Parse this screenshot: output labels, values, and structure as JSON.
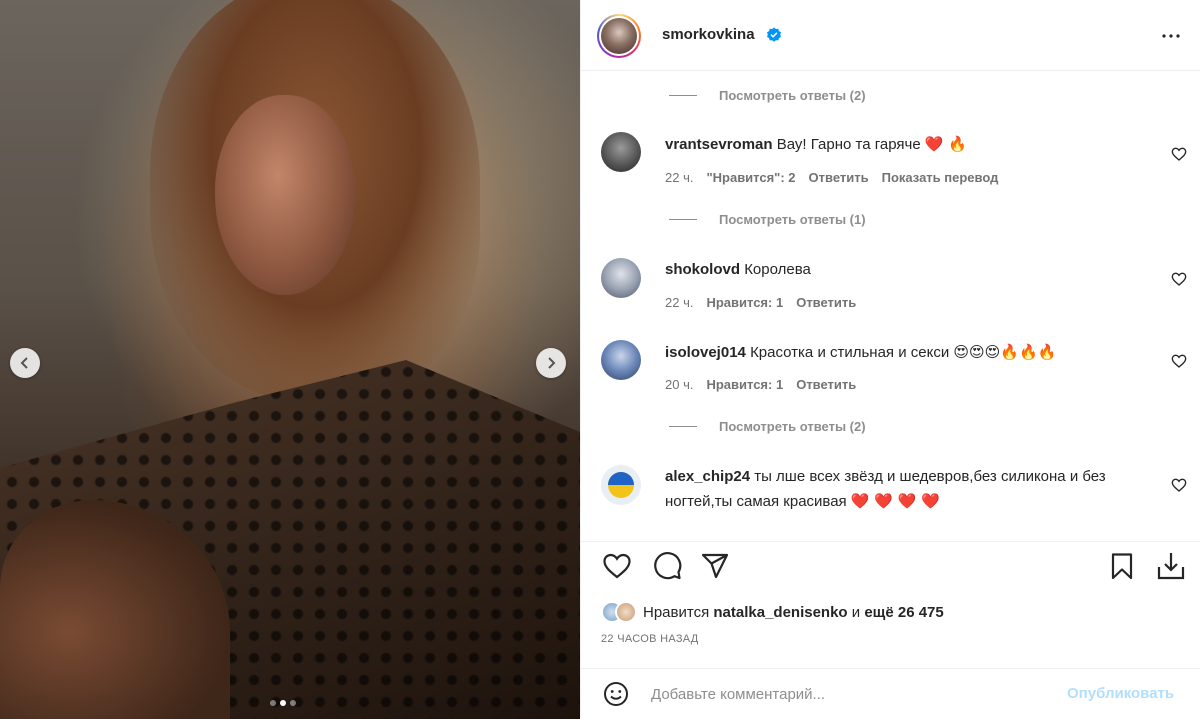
{
  "post": {
    "author": "smorkovkina",
    "verified": true,
    "carousel": {
      "total": 3,
      "current": 2
    }
  },
  "comments": [
    {
      "view_replies": "Посмотреть ответы (2)"
    },
    {
      "user": "vrantsevroman",
      "text": "Вау! Гарно та гаряче",
      "emojis": "❤️ 🔥",
      "time": "22 ч.",
      "likes": "\"Нравится\": 2",
      "reply": "Ответить",
      "translate": "Показать перевод",
      "view_replies": "Посмотреть ответы (1)"
    },
    {
      "user": "shokolovd",
      "text": "Королева",
      "time": "22 ч.",
      "likes": "Нравится: 1",
      "reply": "Ответить"
    },
    {
      "user": "isolovej014",
      "text": "Красотка и стильная и секси",
      "emojis": "😍😍😍🔥🔥🔥",
      "time": "20 ч.",
      "likes": "Нравится: 1",
      "reply": "Ответить",
      "view_replies": "Посмотреть ответы (2)"
    },
    {
      "user": "alex_chip24",
      "text": "ты лше всех звёзд и шедевров,без силикона и без ногтей,ты самая красивая",
      "emojis": "❤️ ❤️ ❤️ ❤️"
    }
  ],
  "actions": {
    "likes_prefix": "Нравится",
    "liked_by": "natalka_denisenko",
    "likes_and": "и",
    "likes_more": "ещё 26 475",
    "timestamp": "22 ЧАСОВ НАЗАД"
  },
  "add_comment": {
    "placeholder": "Добавьте комментарий...",
    "publish": "Опубликовать"
  },
  "colors": {
    "text": "#262626",
    "muted": "#737373",
    "verified": "#0095f6",
    "publish_disabled": "#b2dffc",
    "heart": "#ed4956"
  },
  "icons": [
    "chevron-left-icon",
    "chevron-right-icon",
    "verified-icon",
    "more-icon",
    "heart-icon",
    "comment-icon",
    "share-icon",
    "bookmark-icon",
    "download-icon",
    "emoji-icon"
  ]
}
